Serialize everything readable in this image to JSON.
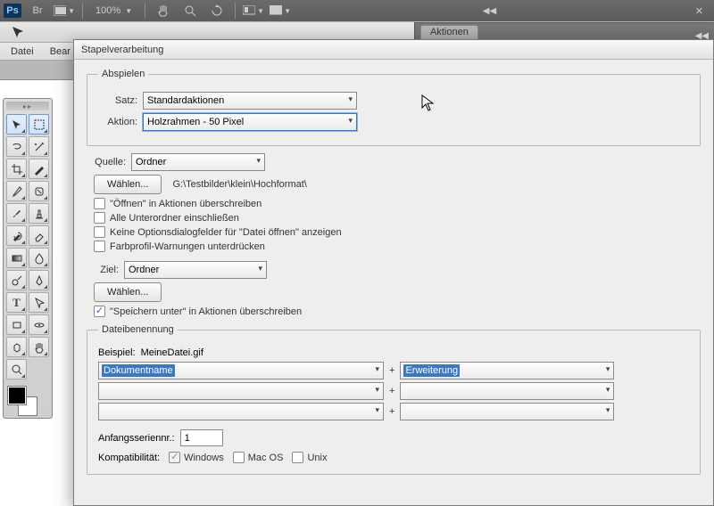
{
  "app": {
    "name": "Ps",
    "br": "Br",
    "zoom": "100% "
  },
  "panels": {
    "aktionen": "Aktionen"
  },
  "menu": {
    "file": "Datei",
    "editPrefix": "Bear"
  },
  "tools": {
    "names": [
      "move",
      "marquee",
      "lasso",
      "wand",
      "crop",
      "slice",
      "eyedropper",
      "patch",
      "brush",
      "stamp",
      "history",
      "eraser",
      "gradient",
      "blur",
      "dodge",
      "pen",
      "type",
      "path",
      "shape",
      "hand",
      "zoom3d",
      "rotate",
      "rotate3d"
    ]
  },
  "dialog": {
    "title": "Stapelverarbeitung",
    "play": {
      "legend": "Abspielen",
      "setLabel": "Satz:",
      "setValue": "Standardaktionen",
      "actionLabel": "Aktion:",
      "actionValue": "Holzrahmen - 50 Pixel"
    },
    "source": {
      "label": "Quelle:",
      "value": "Ordner",
      "chooseBtn": "Wählen...",
      "path": "G:\\Testbilder\\klein\\Hochformat\\",
      "cb1": "\"Öffnen\" in Aktionen überschreiben",
      "cb2": "Alle Unterordner einschließen",
      "cb3": "Keine Optionsdialogfelder für \"Datei öffnen\" anzeigen",
      "cb4": "Farbprofil-Warnungen unterdrücken"
    },
    "dest": {
      "label": "Ziel:",
      "value": "Ordner",
      "chooseBtn": "Wählen...",
      "cbSave": "\"Speichern unter\" in Aktionen überschreiben"
    },
    "naming": {
      "legend": "Dateibenennung",
      "exampleLabel": "Beispiel:",
      "exampleValue": "MeineDatei.gif",
      "slot1": "Dokumentname",
      "slot2": "Erweiterung",
      "serialLabel": "Anfangsseriennr.:",
      "serialValue": "1",
      "compatLabel": "Kompatibilität:",
      "compatWindows": "Windows",
      "compatMac": "Mac OS",
      "compatUnix": "Unix"
    }
  }
}
